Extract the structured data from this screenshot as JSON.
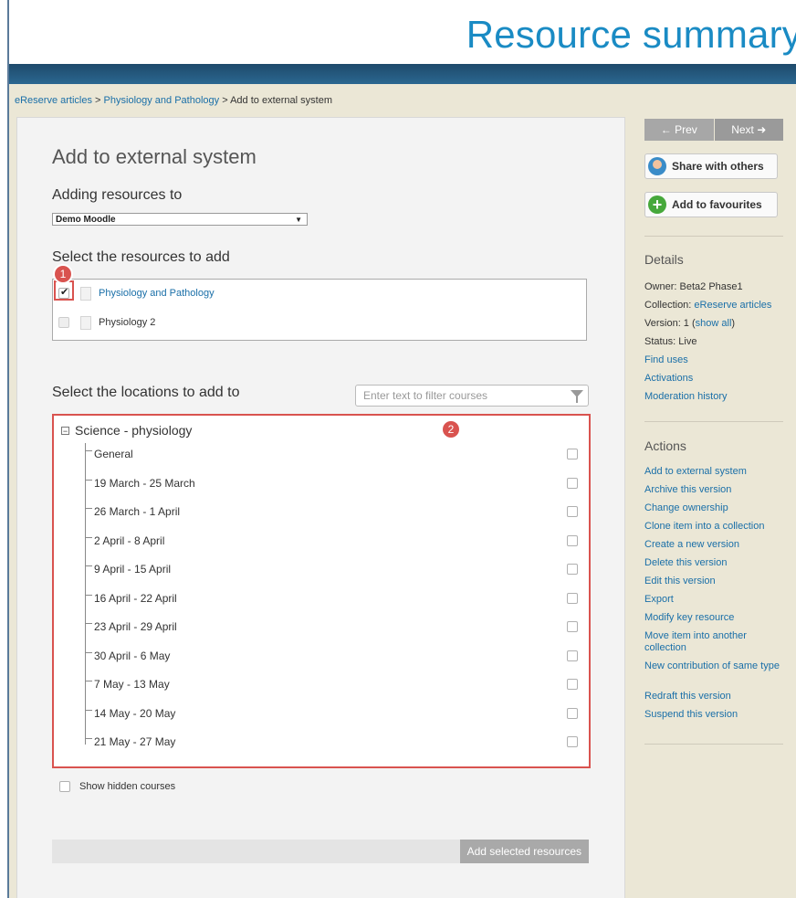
{
  "header": {
    "title": "Resource summary"
  },
  "breadcrumb": {
    "crumb1": "eReserve articles",
    "sep1": ">",
    "crumb2": "Physiology and Pathology",
    "sep2": ">",
    "current": "Add to external system"
  },
  "main": {
    "title": "Add to external system",
    "adding_label": "Adding resources to",
    "adding_select_value": "Demo Moodle",
    "select_resources_label": "Select the resources to add",
    "resources": [
      {
        "label": "Physiology and Pathology",
        "checked": true
      },
      {
        "label": "Physiology 2",
        "checked": false
      }
    ],
    "select_locations_label": "Select the locations to add to",
    "filter_placeholder": "Enter text to filter courses",
    "tree_root": "Science - physiology",
    "expander_glyph": "−",
    "tree_items": [
      "General",
      "19 March - 25 March",
      "26 March - 1 April",
      "2 April - 8 April",
      "9 April - 15 April",
      "16 April - 22 April",
      "23 April - 29 April",
      "30 April - 6 May",
      "7 May - 13 May",
      "14 May - 20 May",
      "21 May - 27 May"
    ],
    "show_hidden_label": "Show hidden courses",
    "add_button": "Add selected resources",
    "badge1": "1",
    "badge2": "2"
  },
  "sidebar": {
    "prev": "← Prev",
    "next": "Next ➜",
    "share": "Share with others",
    "favourites": "Add to favourites",
    "details_heading": "Details",
    "owner": "Owner: Beta2 Phase1",
    "collection_label": "Collection:",
    "collection_value": "eReserve articles",
    "version_label": "Version: 1 (",
    "version_link": "show all",
    "version_close": ")",
    "status": "Status: Live",
    "detail_links": [
      "Find uses",
      "Activations",
      "Moderation history"
    ],
    "actions_heading": "Actions",
    "actions": [
      "Add to external system",
      "Archive this version",
      "Change ownership",
      "Clone item into a collection",
      "Create a new version",
      "Delete this version",
      "Edit this version",
      "Export",
      "Modify key resource",
      "Move item into another collection",
      "New contribution of same type",
      "Redraft this version",
      "Suspend this version"
    ]
  },
  "colors": {
    "accent_blue": "#1a8bc4",
    "band_navy": "#1e4a6b",
    "highlight_red": "#d9534f",
    "sidebar_bg": "#ebe7d6"
  },
  "icons": [
    "share-people-icon",
    "add-favourite-icon",
    "filter-funnel-icon",
    "document-icon",
    "tree-collapse-icon"
  ]
}
